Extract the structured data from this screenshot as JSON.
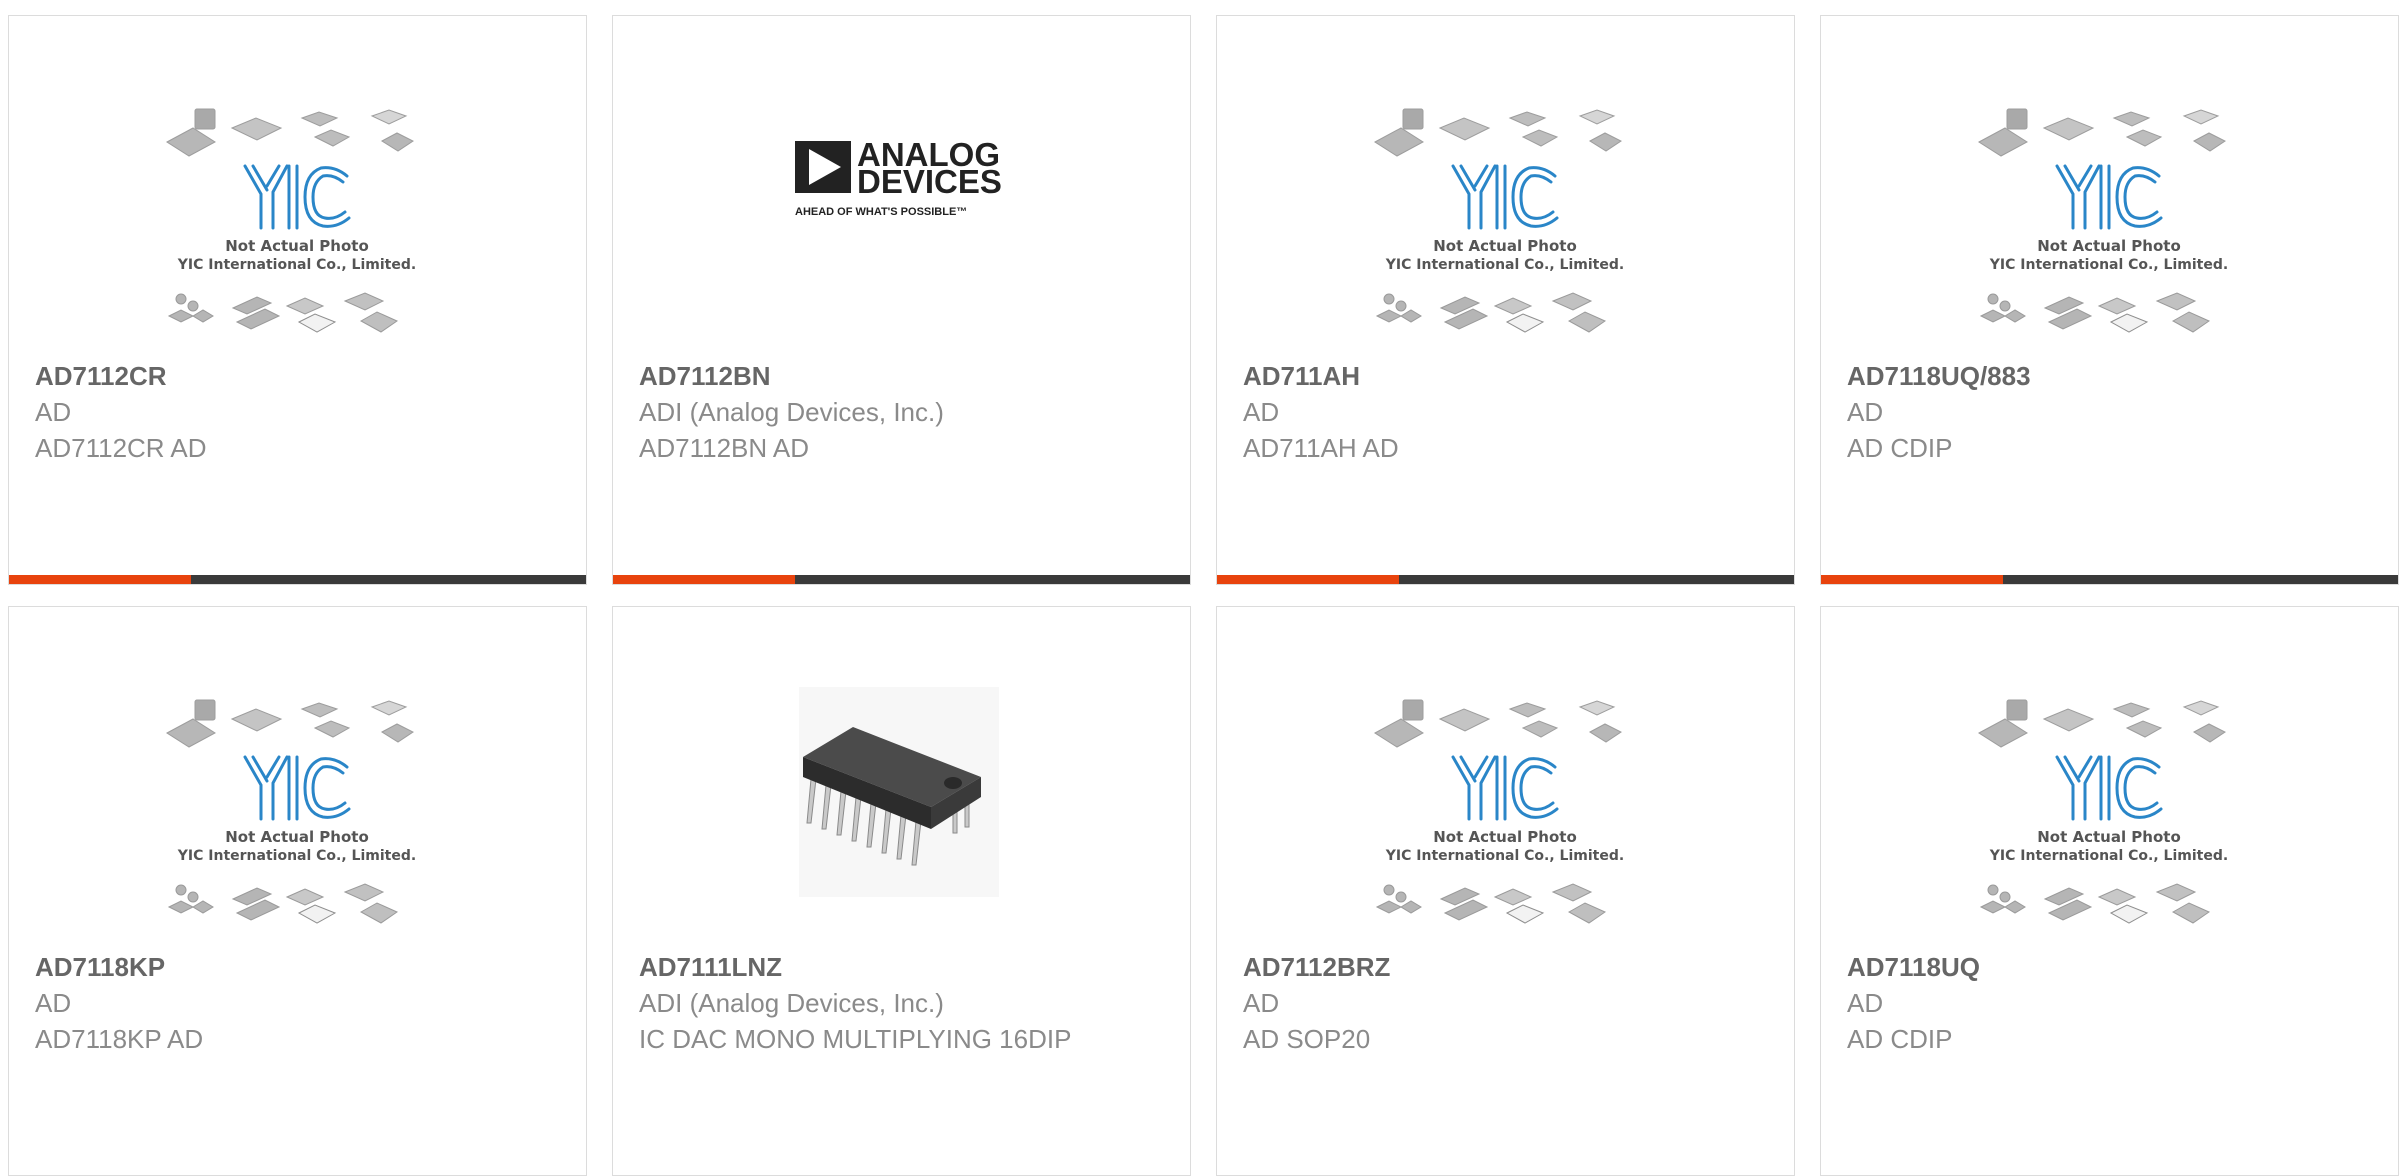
{
  "accent_color": "#e8430d",
  "bar_color": "#3a3a3a",
  "placeholder_image": {
    "caption_line1": "Not Actual Photo",
    "caption_line2": "YIC International Co., Limited.",
    "logo_text": "YIC"
  },
  "adi_logo": {
    "line1": "ANALOG",
    "line2": "DEVICES",
    "tagline": "AHEAD OF WHAT'S POSSIBLE™"
  },
  "products": [
    {
      "part_number": "AD7112CR",
      "manufacturer": "AD",
      "description": "AD7112CR AD",
      "image": "yic-placeholder",
      "show_bar": true
    },
    {
      "part_number": "AD7112BN",
      "manufacturer": "ADI (Analog Devices, Inc.)",
      "description": "AD7112BN AD",
      "image": "analog-devices-logo",
      "show_bar": true
    },
    {
      "part_number": "AD711AH",
      "manufacturer": "AD",
      "description": "AD711AH AD",
      "image": "yic-placeholder",
      "show_bar": true
    },
    {
      "part_number": "AD7118UQ/883",
      "manufacturer": "AD",
      "description": "AD CDIP",
      "image": "yic-placeholder",
      "show_bar": true
    },
    {
      "part_number": "AD7118KP",
      "manufacturer": "AD",
      "description": "AD7118KP AD",
      "image": "yic-placeholder",
      "show_bar": false
    },
    {
      "part_number": "AD7111LNZ",
      "manufacturer": "ADI (Analog Devices, Inc.)",
      "description": "IC DAC MONO MULTIPLYING 16DIP",
      "image": "dip-chip-photo",
      "show_bar": false
    },
    {
      "part_number": "AD7112BRZ",
      "manufacturer": "AD",
      "description": "AD SOP20",
      "image": "yic-placeholder",
      "show_bar": false
    },
    {
      "part_number": "AD7118UQ",
      "manufacturer": "AD",
      "description": "AD CDIP",
      "image": "yic-placeholder",
      "show_bar": false
    }
  ]
}
